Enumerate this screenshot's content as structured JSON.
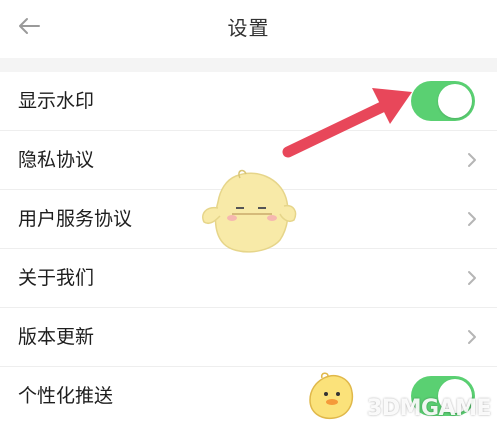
{
  "header": {
    "title": "设置",
    "back_icon": "arrow-left-icon"
  },
  "settings": {
    "rows": [
      {
        "label": "显示水印",
        "control": "toggle",
        "on": true
      },
      {
        "label": "隐私协议",
        "control": "chevron"
      },
      {
        "label": "用户服务协议",
        "control": "chevron"
      },
      {
        "label": "关于我们",
        "control": "chevron"
      },
      {
        "label": "版本更新",
        "control": "chevron"
      },
      {
        "label": "个性化推送",
        "control": "toggle",
        "on": true
      }
    ]
  },
  "colors": {
    "toggle_on": "#5ad072",
    "arrow": "#e8475a",
    "mascot": "#f8eaa8"
  },
  "overlay": {
    "annotation": "red-arrow-pointing-to-toggle",
    "watermark_text": "3DMGAME"
  }
}
